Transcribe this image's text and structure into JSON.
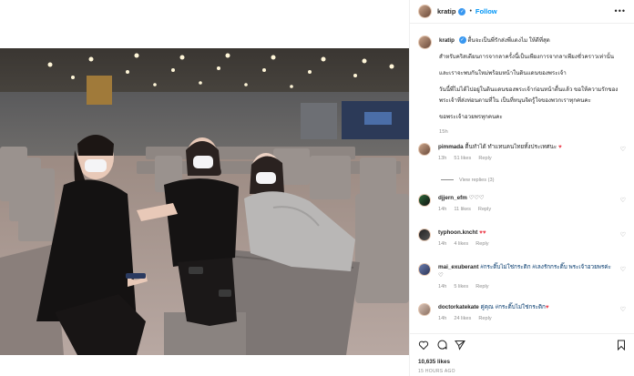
{
  "post": {
    "username": "kratip",
    "follow_label": "Follow",
    "more_icon": "more-horizontal-icon",
    "caption_lines": [
      "ตื้นจะเป็นพี่รักส่งพี่แดงไม ให้ดีที่สุด",
      "สำหรับคริสเตียนการจากลาครั้งนี้เป็นเพียงการจากลาเพียงชั่วคราวเท่านั้น",
      "และเราจะพบกันใหม่พร้อมหน้าในดินแดนของพระเจ้า",
      "วันนี้พี่ไม่ได้ไปอยู่ในดินแดนของพระเจ้าก่อนหน้าตื้นแล้ว ขอให้ความรักของพระเจ้าที่ส่งท่อนตามที่ใน เป็นที่หนุนจิตรู้ใจของพวกเราทุกคนคะ",
      "ขอพระเจ้าอวยพรทุกคนคะ"
    ],
    "caption_time": "15h",
    "likes": "10,635 likes",
    "timestamp": "15 HOURS AGO"
  },
  "comments": [
    {
      "user": "pimmada",
      "text": "ตื้นทำได้ ทำแทนคนไทยทั้งประเทศนะ",
      "emoji": "♥",
      "time": "13h",
      "likes": "51 likes",
      "reply": "Reply"
    },
    {
      "user": "djjern_efm",
      "text": "",
      "emoji": "♡♡♡",
      "time": "14h",
      "likes": "11 likes",
      "reply": "Reply"
    },
    {
      "user": "typhoon.kncht",
      "text": "",
      "emoji": "♥♥",
      "time": "14h",
      "likes": "4 likes",
      "reply": "Reply"
    },
    {
      "user": "mai_exuberant",
      "text": "#กระติ๊บไม่ใช่กระติก #เลงรักกระติ๊บ พระเจ้าอวยพรค่ะ",
      "emoji": "♡",
      "time": "14h",
      "likes": "5 likes",
      "reply": "Reply"
    },
    {
      "user": "doctorkatekate",
      "text": "คู่คุณ #กระติ๊บไม่ใช่กระติก",
      "emoji": "♥",
      "time": "14h",
      "likes": "24 likes",
      "reply": "Reply"
    }
  ],
  "view_replies": "View replies (3)",
  "colors": {
    "link": "#0095f6",
    "verified": "#3897f0",
    "heart_red": "#ed4956",
    "muted": "#8e8e8e"
  }
}
